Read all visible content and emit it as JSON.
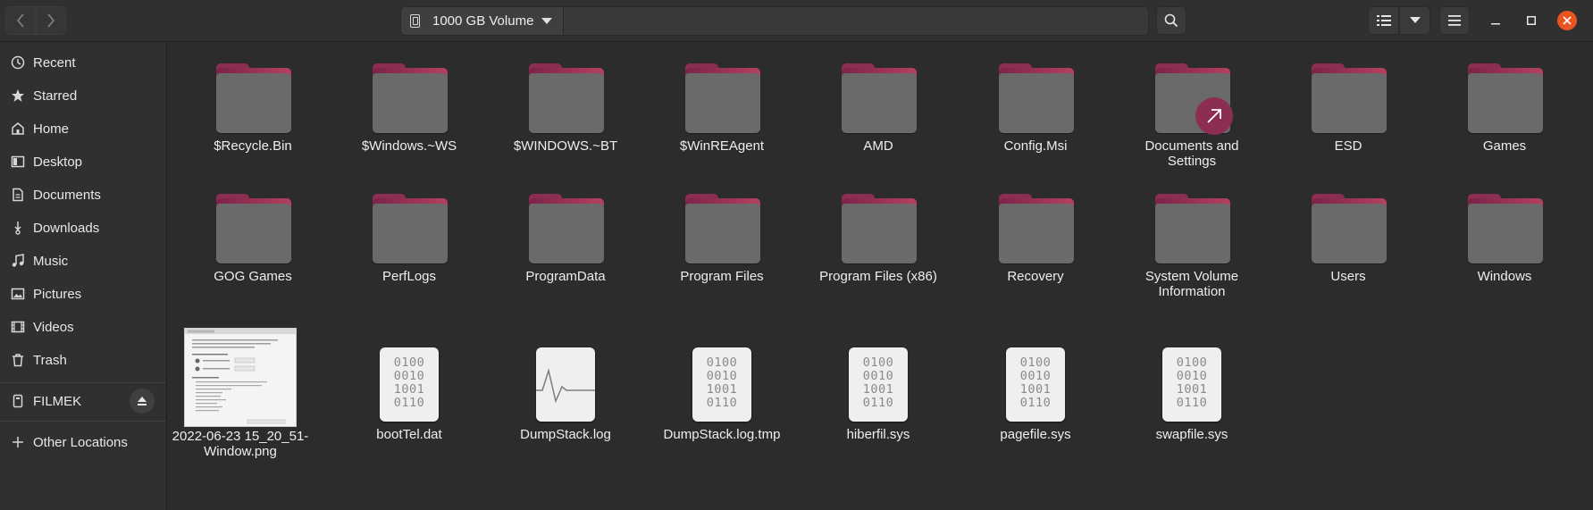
{
  "header": {
    "back_icon": "chevron-left-icon",
    "forward_icon": "chevron-right-icon",
    "location_label": "1000 GB Volume",
    "location_icon": "drive-icon",
    "search_icon": "search-icon",
    "view_icon": "list-view-icon",
    "view_menu_icon": "chevron-down-icon",
    "menu_icon": "hamburger-menu-icon",
    "window_controls": [
      "minimize",
      "maximize",
      "close"
    ]
  },
  "sidebar": {
    "items": [
      {
        "label": "Recent",
        "icon": "clock-icon"
      },
      {
        "label": "Starred",
        "icon": "star-icon"
      },
      {
        "label": "Home",
        "icon": "home-icon"
      },
      {
        "label": "Desktop",
        "icon": "desktop-icon"
      },
      {
        "label": "Documents",
        "icon": "document-icon"
      },
      {
        "label": "Downloads",
        "icon": "download-icon"
      },
      {
        "label": "Music",
        "icon": "music-icon"
      },
      {
        "label": "Pictures",
        "icon": "pictures-icon"
      },
      {
        "label": "Videos",
        "icon": "video-icon"
      },
      {
        "label": "Trash",
        "icon": "trash-icon"
      }
    ],
    "device": {
      "label": "FILMEK",
      "icon": "usb-drive-icon",
      "eject_icon": "eject-icon"
    },
    "other": {
      "label": "Other Locations",
      "icon": "plus-icon"
    }
  },
  "files": {
    "row1": [
      "$Recycle.Bin",
      "$Windows.~WS",
      "$WINDOWS.~BT",
      "$WinREAgent",
      "AMD",
      "Config.Msi",
      "Documents and Settings",
      "ESD",
      "Games"
    ],
    "row2": [
      "GOG Games",
      "PerfLogs",
      "ProgramData",
      "Program Files",
      "Program Files (x86)",
      "Recovery",
      "System Volume Information",
      "Users",
      "Windows"
    ],
    "row3": [
      {
        "name": "2022-06-23 15_20_51-Window.png",
        "type": "image"
      },
      {
        "name": "bootTel.dat",
        "type": "binary"
      },
      {
        "name": "DumpStack.log",
        "type": "log"
      },
      {
        "name": "DumpStack.log.tmp",
        "type": "binary"
      },
      {
        "name": "hiberfil.sys",
        "type": "binary"
      },
      {
        "name": "pagefile.sys",
        "type": "binary"
      },
      {
        "name": "swapfile.sys",
        "type": "binary"
      }
    ],
    "binary_glyph": [
      "0100",
      "0010",
      "1001",
      "0110"
    ],
    "symlink_folder": "Documents and Settings"
  },
  "colors": {
    "accent": "#e95420",
    "folder_tab": "#8c2e52",
    "folder_body": "#6a6a6a",
    "window_bg": "#2c2c2c"
  }
}
